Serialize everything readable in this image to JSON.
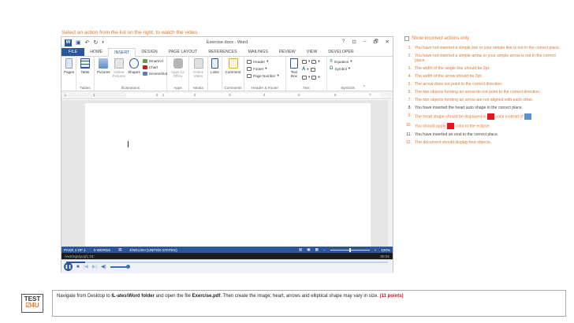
{
  "instruction": "Select an action from the list on the right, to watch the video.",
  "word": {
    "title": "Exercise.docx - Word",
    "window_buttons": [
      "?",
      "⊡",
      "–",
      "🗗",
      "✕"
    ],
    "tabs": [
      "FILE",
      "HOME",
      "INSERT",
      "DESIGN",
      "PAGE LAYOUT",
      "REFERENCES",
      "MAILINGS",
      "REVIEW",
      "VIEW",
      "DEVELOPER"
    ],
    "active_tab": "INSERT",
    "ribbon": {
      "pages": "Pages",
      "table": "Table",
      "tables_group": "Tables",
      "pictures": "Pictures",
      "online_pictures": "Online Pictures",
      "shapes": "Shapes",
      "smartart": "SmartArt",
      "chart": "Chart",
      "screenshot": "Screenshot",
      "illustrations_group": "Illustrations",
      "apps_for_office": "Apps for Office",
      "apps_group": "Apps",
      "online_video": "Online Video",
      "media_group": "Media",
      "links": "Links",
      "comment": "Comment",
      "comments_group": "Comments",
      "header": "Header",
      "footer": "Footer",
      "page_number": "Page Number",
      "header_footer_group": "Header & Footer",
      "text_box": "Text Box",
      "text_group": "Text",
      "equation": "Equation",
      "symbol": "Symbol",
      "symbols_group": "Symbols"
    },
    "ruler_ticks": [
      "1",
      "2",
      "1",
      "2",
      "3",
      "4",
      "5",
      "6",
      "7"
    ],
    "status": {
      "page": "PAGE 1 OF 1",
      "words": "0 WORDS",
      "language": "ENGLISH (UNITED STATES)",
      "zoom": "100%"
    },
    "caption": "Αναπαραγωγή '31'",
    "time": "00:01",
    "progress_fraction": 0.06
  },
  "panel": {
    "toggle_label": "Show incorrect actions only",
    "items": [
      {
        "num": "1.",
        "text": "You have not inserted a simple line or your simple line is not in the correct place.",
        "status": "err"
      },
      {
        "num": "2.",
        "text": "You have not inserted a simple arrow or your simple arrow is not in the correct place.",
        "status": "err"
      },
      {
        "num": "3.",
        "text": "The width of the single line should be 3pt.",
        "status": "err"
      },
      {
        "num": "4.",
        "text": "The width of the arrow should be 3pt.",
        "status": "err"
      },
      {
        "num": "5.",
        "text": "The arrow does not point to the correct direction.",
        "status": "err"
      },
      {
        "num": "6.",
        "text": "The two objects forming an arrow do not point to the correct direction.",
        "status": "err"
      },
      {
        "num": "7.",
        "text": "The two objects forming an arrow are not aligned with each other.",
        "status": "err"
      },
      {
        "num": "8.",
        "text": "You have inserted the heart auto shape in the correct place.",
        "status": "ok"
      },
      {
        "num": "9.",
        "text_a": "The heart shape should be displayed in",
        "text_b": "color instead of",
        "status": "err",
        "swatch_a": "#e8151b",
        "swatch_b": "#5b8fd6"
      },
      {
        "num": "10.",
        "text_a": "You should apply",
        "text_b": "color to the eclipse.",
        "status": "err",
        "swatch_a": "#e8151b"
      },
      {
        "num": "11.",
        "text": "You have inserted an oval in the correct place.",
        "status": "ok"
      },
      {
        "num": "12.",
        "text": "The document should display four objects.",
        "status": "err"
      }
    ]
  },
  "logo": {
    "line1": "TEST",
    "line2_a": "",
    "line2_b": "4U"
  },
  "task": {
    "t1": "Navigate from Desktop to ",
    "t2": "IL-ates\\Word folder",
    "t3": " and open the file ",
    "t4": "Exercise.pdf",
    "t5": ". Then create the image; heart, arrows and elliptical shape may vary in size. ",
    "points": "(11 points)"
  },
  "colors": {
    "accent": "#e8742a",
    "word_blue": "#2b579a",
    "error_red": "#d2151b"
  }
}
